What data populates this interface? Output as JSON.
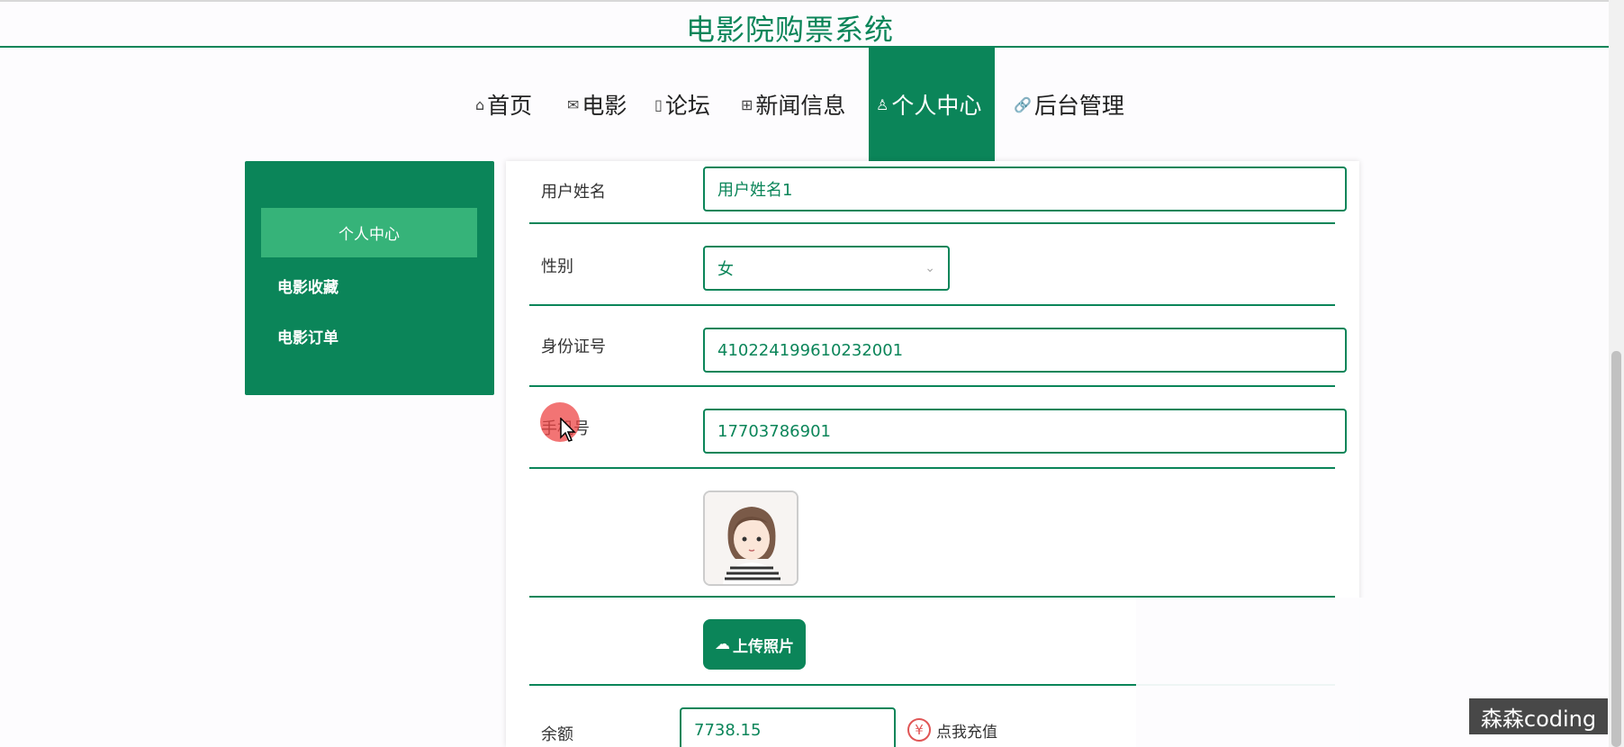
{
  "app": {
    "title": "电影院购票系统"
  },
  "nav": {
    "items": [
      {
        "label": "首页",
        "icon": "home-icon",
        "glyph": "⌂"
      },
      {
        "label": "电影",
        "icon": "mail-icon",
        "glyph": "✉"
      },
      {
        "label": "论坛",
        "icon": "note-icon",
        "glyph": "▯"
      },
      {
        "label": "新闻信息",
        "icon": "gift-icon",
        "glyph": "⊞"
      },
      {
        "label": "个人中心",
        "icon": "user-icon",
        "glyph": "♙",
        "active": true
      },
      {
        "label": "后台管理",
        "icon": "link-icon",
        "glyph": "🔗"
      }
    ]
  },
  "sidebar": {
    "items": [
      {
        "label": "个人中心",
        "active": true
      },
      {
        "label": "电影收藏"
      },
      {
        "label": "电影订单"
      }
    ]
  },
  "form": {
    "username": {
      "label": "用户姓名",
      "value": "用户姓名1"
    },
    "gender": {
      "label": "性别",
      "value": "女"
    },
    "id_number": {
      "label": "身份证号",
      "value": "410224199610232001"
    },
    "phone": {
      "label": "手机号",
      "value": "17703786901"
    },
    "upload_button": "上传照片",
    "balance": {
      "label": "余额",
      "value": "7738.15"
    },
    "recharge_label": "点我充值"
  },
  "watermark": "森森coding",
  "colors": {
    "primary": "#0b8559",
    "sidebar_active": "#36b379",
    "recharge_icon": "#e05555"
  }
}
